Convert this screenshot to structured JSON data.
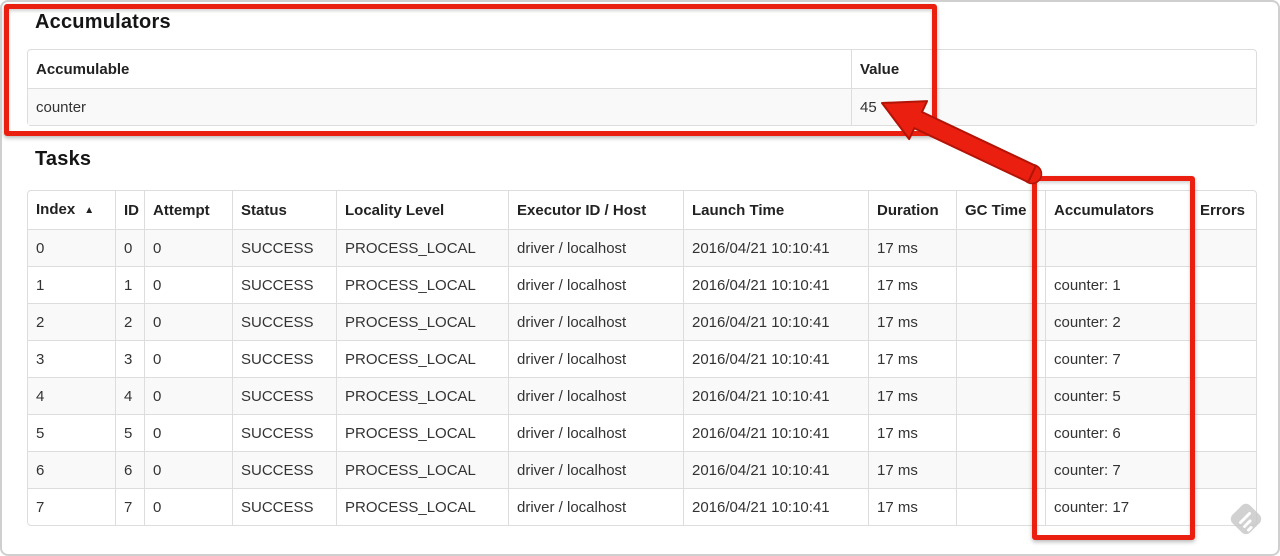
{
  "accumulators": {
    "title": "Accumulators",
    "columns": [
      "Accumulable",
      "Value"
    ],
    "rows": [
      [
        "counter",
        "45"
      ]
    ]
  },
  "tasks": {
    "title": "Tasks",
    "columns": [
      "Index",
      "ID",
      "Attempt",
      "Status",
      "Locality Level",
      "Executor ID / Host",
      "Launch Time",
      "Duration",
      "GC Time",
      "Accumulators",
      "Errors"
    ],
    "sort": {
      "column": "Index",
      "direction": "ascending",
      "icon": "▲"
    },
    "rows": [
      [
        "0",
        "0",
        "0",
        "SUCCESS",
        "PROCESS_LOCAL",
        "driver / localhost",
        "2016/04/21 10:10:41",
        "17 ms",
        "",
        "",
        ""
      ],
      [
        "1",
        "1",
        "0",
        "SUCCESS",
        "PROCESS_LOCAL",
        "driver / localhost",
        "2016/04/21 10:10:41",
        "17 ms",
        "",
        "counter: 1",
        ""
      ],
      [
        "2",
        "2",
        "0",
        "SUCCESS",
        "PROCESS_LOCAL",
        "driver / localhost",
        "2016/04/21 10:10:41",
        "17 ms",
        "",
        "counter: 2",
        ""
      ],
      [
        "3",
        "3",
        "0",
        "SUCCESS",
        "PROCESS_LOCAL",
        "driver / localhost",
        "2016/04/21 10:10:41",
        "17 ms",
        "",
        "counter: 7",
        ""
      ],
      [
        "4",
        "4",
        "0",
        "SUCCESS",
        "PROCESS_LOCAL",
        "driver / localhost",
        "2016/04/21 10:10:41",
        "17 ms",
        "",
        "counter: 5",
        ""
      ],
      [
        "5",
        "5",
        "0",
        "SUCCESS",
        "PROCESS_LOCAL",
        "driver / localhost",
        "2016/04/21 10:10:41",
        "17 ms",
        "",
        "counter: 6",
        ""
      ],
      [
        "6",
        "6",
        "0",
        "SUCCESS",
        "PROCESS_LOCAL",
        "driver / localhost",
        "2016/04/21 10:10:41",
        "17 ms",
        "",
        "counter: 7",
        ""
      ],
      [
        "7",
        "7",
        "0",
        "SUCCESS",
        "PROCESS_LOCAL",
        "driver / localhost",
        "2016/04/21 10:10:41",
        "17 ms",
        "",
        "counter: 17",
        ""
      ]
    ]
  },
  "annotations": {
    "highlight_color": "#ea1f10",
    "highlighted_value": "45",
    "highlighted_column": "Accumulators"
  },
  "icons": {
    "sort_ascending": "▲",
    "watermark": "feedly-icon"
  },
  "colors": {
    "annotation_red": "#ea1f10",
    "table_border": "#dddddd",
    "row_stripe": "#f9f9f9",
    "text": "#333333"
  }
}
